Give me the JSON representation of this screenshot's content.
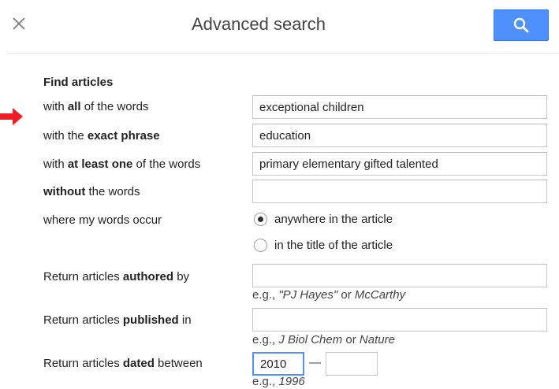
{
  "header": {
    "title": "Advanced search",
    "close_icon": "close-icon",
    "search_icon": "search-icon",
    "accent_color": "#4d90fe"
  },
  "annotation": {
    "arrow_color": "#ee1c25",
    "arrow_icon": "right-arrow-icon"
  },
  "form": {
    "heading": "Find articles",
    "all_words": {
      "label_pre": "with ",
      "label_bold": "all",
      "label_post": " of the words",
      "value": "exceptional children"
    },
    "exact_phrase": {
      "label_pre": "with the ",
      "label_bold": "exact phrase",
      "label_post": "",
      "value": "education"
    },
    "at_least_one": {
      "label_pre": "with ",
      "label_bold": "at least one",
      "label_post": " of the words",
      "value": "primary elementary gifted talented"
    },
    "without": {
      "label_pre": "",
      "label_bold": "without",
      "label_post": " the words",
      "value": ""
    },
    "occur": {
      "label": "where my words occur",
      "options": [
        {
          "label": "anywhere in the article",
          "selected": true
        },
        {
          "label": "in the title of the article",
          "selected": false
        }
      ]
    },
    "authored": {
      "label_pre": "Return articles ",
      "label_bold": "authored",
      "label_post": " by",
      "value": "",
      "example_pre": "e.g., ",
      "example_i1": "\"PJ Hayes\"",
      "example_mid": " or ",
      "example_i2": "McCarthy"
    },
    "published": {
      "label_pre": "Return articles ",
      "label_bold": "published",
      "label_post": " in",
      "value": "",
      "example_pre": "e.g., ",
      "example_i1": "J Biol Chem",
      "example_mid": " or ",
      "example_i2": "Nature"
    },
    "dated": {
      "label_pre": "Return articles ",
      "label_bold": "dated",
      "label_post": " between",
      "from_value": "2010",
      "dash": "—",
      "to_value": "",
      "example_pre": "e.g., ",
      "example_i1": "1996"
    }
  }
}
